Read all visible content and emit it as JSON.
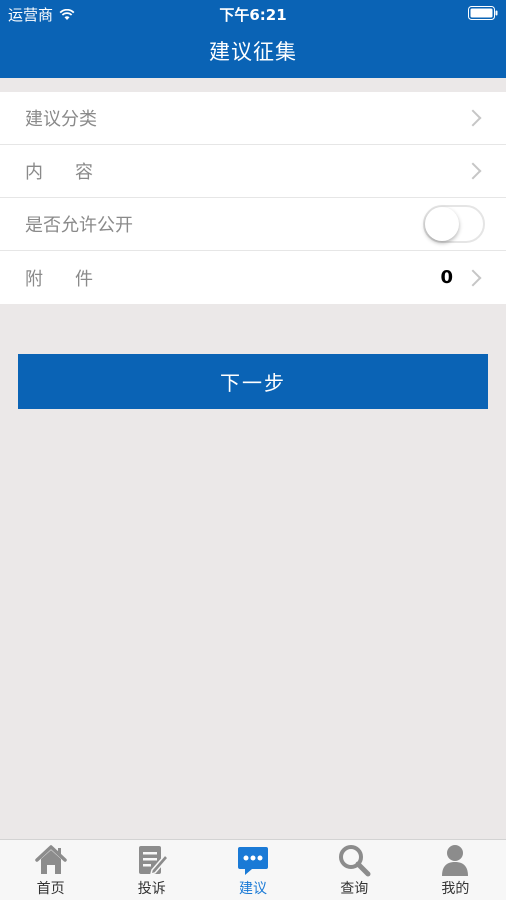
{
  "status_bar": {
    "carrier": "运营商",
    "time": "下午6:21"
  },
  "header": {
    "title": "建议征集"
  },
  "form": {
    "category_label": "建议分类",
    "content_label": "内容",
    "public_label": "是否允许公开",
    "public_enabled": false,
    "attachment_label": "附件",
    "attachment_count": "0"
  },
  "next_button": "下一步",
  "tabs": [
    {
      "label": "首页",
      "icon": "home-icon"
    },
    {
      "label": "投诉",
      "icon": "complaint-icon"
    },
    {
      "label": "建议",
      "icon": "suggestion-icon",
      "active": true
    },
    {
      "label": "查询",
      "icon": "search-icon"
    },
    {
      "label": "我的",
      "icon": "person-icon"
    }
  ],
  "colors": {
    "primary": "#0a63b5",
    "active_tab": "#1a7ad6",
    "background": "#ebe8e8"
  }
}
